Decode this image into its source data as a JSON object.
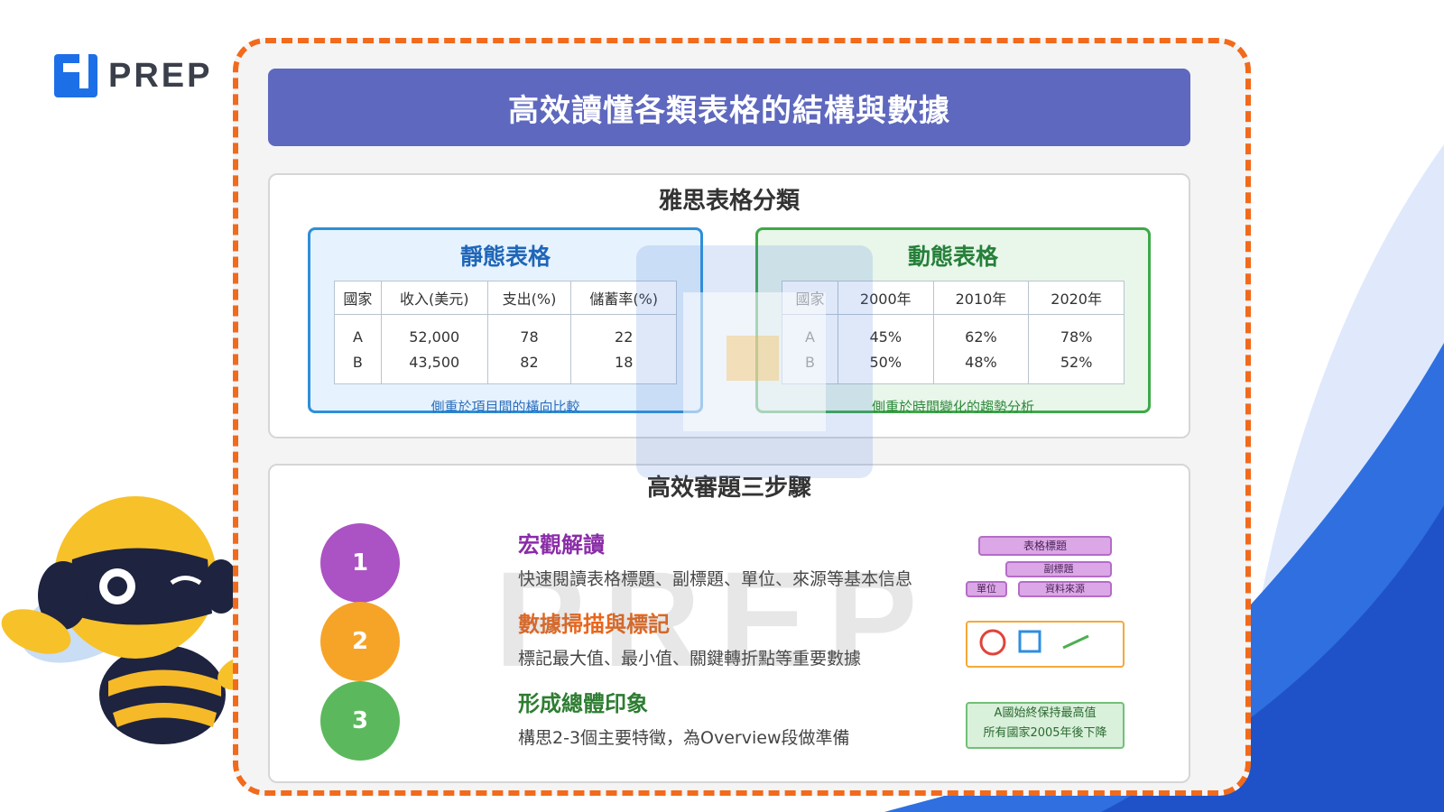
{
  "brand": {
    "name": "PREP"
  },
  "colors": {
    "frame": "#f26a1b",
    "title_bar": "#5e68bf",
    "static_border": "#2e8fd8",
    "dynamic_border": "#3fa84a",
    "step1": "#ab52c4",
    "step2": "#f6a428",
    "step3": "#5cb85c"
  },
  "title": "高效讀懂各類表格的結構與數據",
  "classification": {
    "heading": "雅思表格分類",
    "static": {
      "title": "靜態表格",
      "headers": [
        "國家",
        "收入(美元)",
        "支出(%)",
        "儲蓄率(%)"
      ],
      "rows": [
        [
          "A",
          "52,000",
          "78",
          "22"
        ],
        [
          "B",
          "43,500",
          "82",
          "18"
        ]
      ],
      "note": "側重於項目間的橫向比較"
    },
    "dynamic": {
      "title": "動態表格",
      "headers": [
        "國家",
        "2000年",
        "2010年",
        "2020年"
      ],
      "rows": [
        [
          "A",
          "45%",
          "62%",
          "78%"
        ],
        [
          "B",
          "50%",
          "48%",
          "52%"
        ]
      ],
      "note": "側重於時間變化的趨勢分析"
    }
  },
  "steps": {
    "heading": "高效審題三步驟",
    "items": [
      {
        "number": "1",
        "title": "宏觀解讀",
        "desc": "快速閱讀表格標題、副標題、單位、來源等基本信息"
      },
      {
        "number": "2",
        "title": "數據掃描與標記",
        "desc": "標記最大值、最小值、關鍵轉折點等重要數據"
      },
      {
        "number": "3",
        "title": "形成總體印象",
        "desc": "構思2-3個主要特徵，為Overview段做準備"
      }
    ],
    "illustration": {
      "labels": [
        "表格標題",
        "副標題",
        "單位",
        "資料來源"
      ],
      "summary": [
        "A國始終保持最高值",
        "所有國家2005年後下降"
      ]
    }
  },
  "watermark": "PREP"
}
